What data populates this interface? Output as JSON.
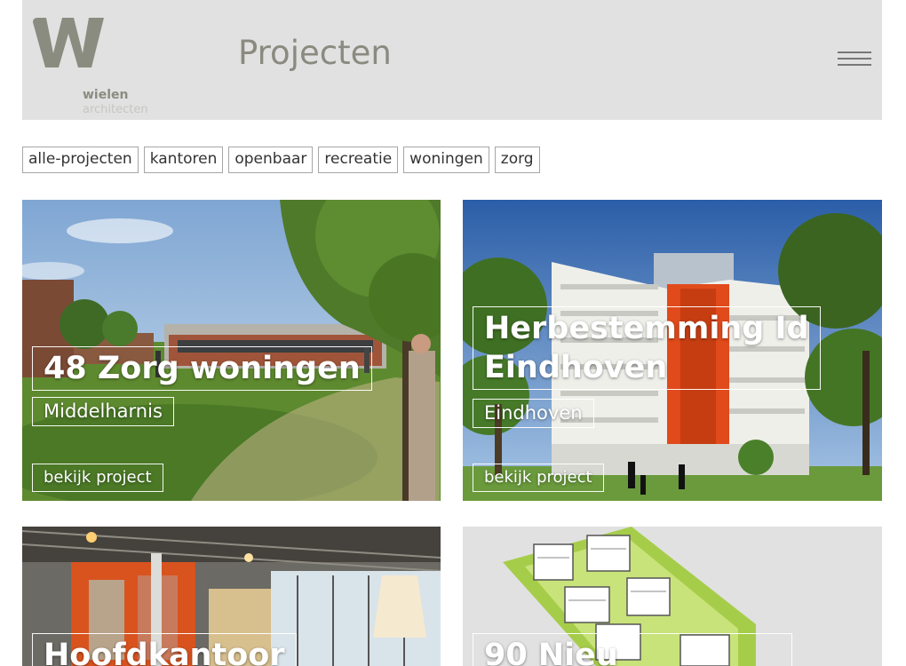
{
  "header": {
    "logo_name": "wielen",
    "logo_sub": "architecten",
    "title": "Projecten",
    "menu_icon": "hamburger-icon"
  },
  "filters": [
    "alle-projecten",
    "kantoren",
    "openbaar",
    "recreatie",
    "woningen",
    "zorg"
  ],
  "projects": [
    {
      "title": "48 Zorg woningen",
      "place": "Middelharnis",
      "link": "bekijk project"
    },
    {
      "title_line1": "Herbestemming Id",
      "title_line2": "Eindhoven",
      "place": "Eindhoven",
      "link": "bekijk project"
    },
    {
      "title": "Hoofdkantoor"
    },
    {
      "title": "90 Nieu"
    }
  ],
  "colors": {
    "header_bg": "#e1e1e1",
    "logo": "#8a8c80",
    "title": "#8a8a80",
    "accent_orange": "#e14a1b"
  }
}
